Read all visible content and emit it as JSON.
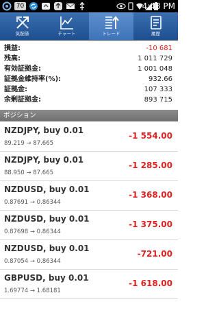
{
  "status_bar": {
    "notification_count": "70",
    "time": "4:48 PM"
  },
  "tabs": [
    {
      "label": "気配値",
      "icon": "quotes-icon",
      "active": false
    },
    {
      "label": "チャート",
      "icon": "chart-icon",
      "active": false
    },
    {
      "label": "トレード",
      "icon": "trade-icon",
      "active": true
    },
    {
      "label": "履歴",
      "icon": "history-icon",
      "active": false
    }
  ],
  "account": [
    {
      "label": "損益:",
      "value": "-10 681",
      "negative": true
    },
    {
      "label": "残高:",
      "value": "1 011 729",
      "negative": false
    },
    {
      "label": "有効証拠金:",
      "value": "1 001 048",
      "negative": false
    },
    {
      "label": "証拠金維持率(%):",
      "value": "932.66",
      "negative": false
    },
    {
      "label": "証拠金:",
      "value": "107 333",
      "negative": false
    },
    {
      "label": "余剰証拠金:",
      "value": "893 715",
      "negative": false
    }
  ],
  "positions_header": "ポジション",
  "positions": [
    {
      "title": "NZDJPY, buy 0.01",
      "prices": "89.219 → 87.665",
      "profit": "-1 554.00"
    },
    {
      "title": "NZDJPY, buy 0.01",
      "prices": "88.950 → 87.665",
      "profit": "-1 285.00"
    },
    {
      "title": "NZDUSD, buy 0.01",
      "prices": "0.87691 → 0.86344",
      "profit": "-1 368.00"
    },
    {
      "title": "NZDUSD, buy 0.01",
      "prices": "0.87698 → 0.86344",
      "profit": "-1 375.00"
    },
    {
      "title": "NZDUSD, buy 0.01",
      "prices": "0.87054 → 0.86344",
      "profit": "-721.00"
    },
    {
      "title": "GBPUSD, buy 0.01",
      "prices": "1.69774 → 1.68181",
      "profit": "-1 618.00"
    }
  ],
  "colors": {
    "tab_bar": "#1e4f8f",
    "tab_active": "#4a80c4",
    "loss_red": "#e02020",
    "section_header": "#7a7a7a"
  }
}
